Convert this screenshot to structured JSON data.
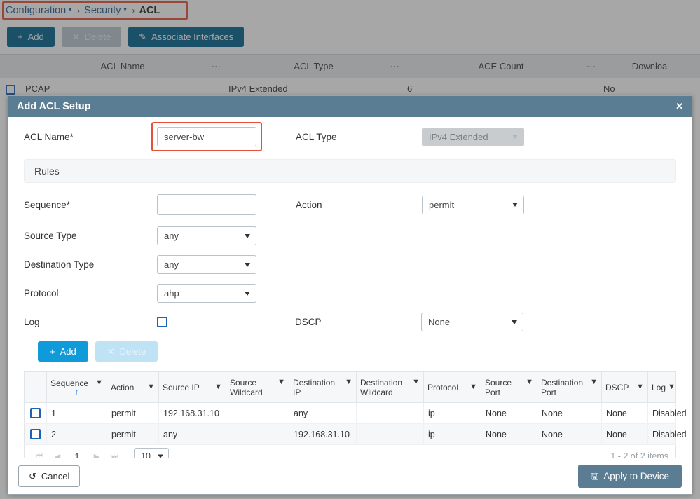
{
  "breadcrumb": {
    "items": [
      {
        "label": "Configuration",
        "has_caret": true
      },
      {
        "label": "Security",
        "has_caret": true
      },
      {
        "label": "ACL",
        "has_caret": false
      }
    ],
    "separator": "›"
  },
  "toolbar": {
    "add_label": "Add",
    "add_icon": "plus-icon",
    "delete_label": "Delete",
    "delete_icon": "close-icon",
    "associate_label": "Associate Interfaces",
    "associate_icon": "pencil-icon"
  },
  "background_table": {
    "columns": [
      "",
      "ACL Name",
      "ACL Type",
      "ACE Count",
      "Downloa"
    ],
    "rows": [
      {
        "name": "PCAP",
        "type": "IPv4 Extended",
        "ace_count": "6",
        "download": "No"
      }
    ]
  },
  "modal": {
    "title": "Add ACL Setup",
    "close_icon": "close-icon",
    "acl_name_label": "ACL Name*",
    "acl_name_value": "server-bw",
    "acl_type_label": "ACL Type",
    "acl_type_value": "IPv4 Extended",
    "rules_section_label": "Rules",
    "fields": {
      "sequence_label": "Sequence*",
      "sequence_value": "",
      "action_label": "Action",
      "action_value": "permit",
      "source_type_label": "Source Type",
      "source_type_value": "any",
      "destination_type_label": "Destination Type",
      "destination_type_value": "any",
      "protocol_label": "Protocol",
      "protocol_value": "ahp",
      "log_label": "Log",
      "dscp_label": "DSCP",
      "dscp_value": "None"
    },
    "rule_buttons": {
      "add_label": "Add",
      "add_icon": "plus-icon",
      "delete_label": "Delete",
      "delete_icon": "close-icon"
    },
    "grid": {
      "columns": [
        {
          "label": "Sequence",
          "sorted": true,
          "sort_icon": "sort-asc-arrow",
          "filter_icon": "filter-icon"
        },
        {
          "label": "Action",
          "filter_icon": "filter-icon"
        },
        {
          "label": "Source IP",
          "filter_icon": "filter-icon"
        },
        {
          "label": "Source Wildcard",
          "filter_icon": "filter-icon"
        },
        {
          "label": "Destination IP",
          "filter_icon": "filter-icon"
        },
        {
          "label": "Destination Wildcard",
          "filter_icon": "filter-icon"
        },
        {
          "label": "Protocol",
          "filter_icon": "filter-icon"
        },
        {
          "label": "Source Port",
          "filter_icon": "filter-icon"
        },
        {
          "label": "Destination Port",
          "filter_icon": "filter-icon"
        },
        {
          "label": "DSCP",
          "filter_icon": "filter-icon"
        },
        {
          "label": "Log",
          "filter_icon": "filter-icon"
        }
      ],
      "rows": [
        {
          "sequence": "1",
          "action": "permit",
          "source_ip": "192.168.31.10",
          "source_wildcard": "",
          "destination_ip": "any",
          "destination_wildcard": "",
          "protocol": "ip",
          "source_port": "None",
          "destination_port": "None",
          "dscp": "None",
          "log": "Disabled"
        },
        {
          "sequence": "2",
          "action": "permit",
          "source_ip": "any",
          "source_wildcard": "",
          "destination_ip": "192.168.31.10",
          "destination_wildcard": "",
          "protocol": "ip",
          "source_port": "None",
          "destination_port": "None",
          "dscp": "None",
          "log": "Disabled"
        }
      ]
    },
    "pagination": {
      "first_icon": "page-first-icon",
      "prev_icon": "page-prev-icon",
      "current_page": "1",
      "next_icon": "page-next-icon",
      "last_icon": "page-last-icon",
      "page_size": "10",
      "items_summary": "1 - 2 of 2 items"
    },
    "footer": {
      "cancel_label": "Cancel",
      "cancel_icon": "undo-icon",
      "apply_label": "Apply to Device",
      "apply_icon": "save-disk-icon"
    }
  },
  "colors": {
    "accent_blue": "#00628f",
    "modal_header": "#5b7d94",
    "rule_add_blue": "#0f9ada",
    "highlight_red": "#e8503a",
    "checkbox_blue": "#1b62b5"
  }
}
